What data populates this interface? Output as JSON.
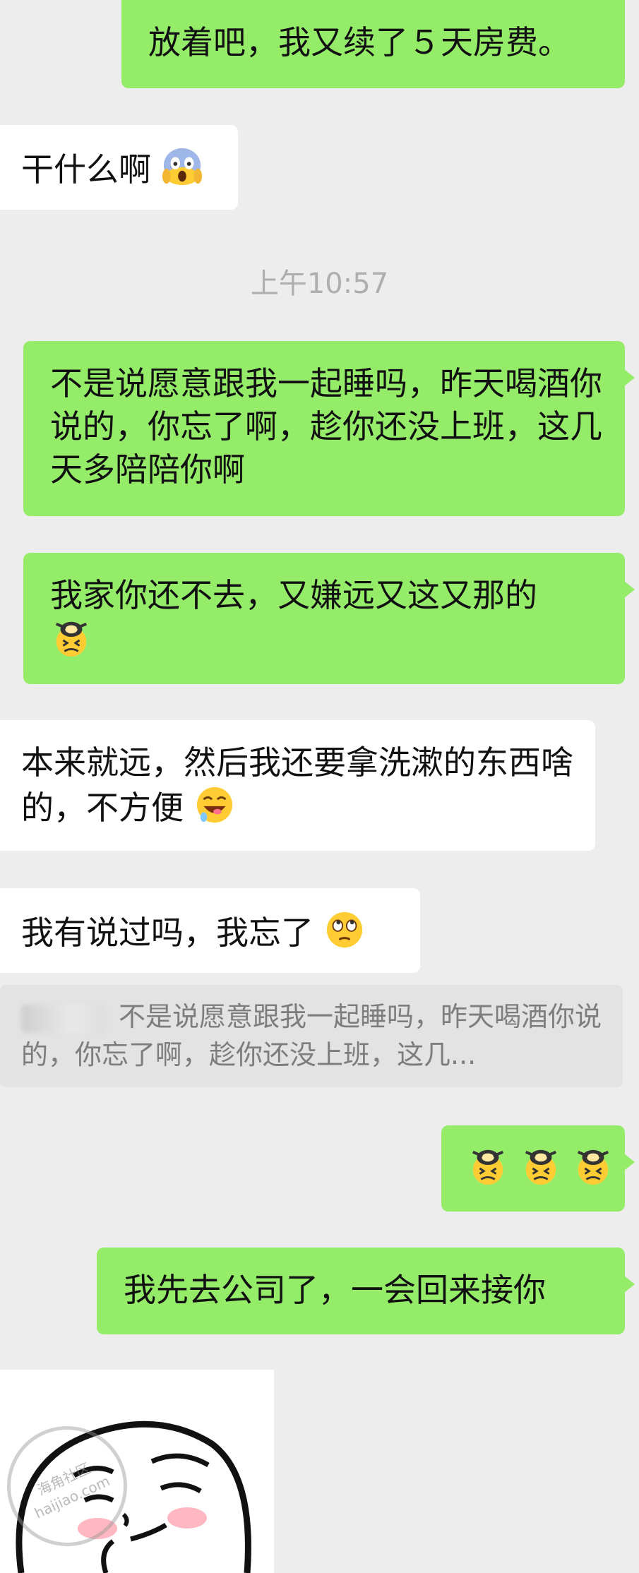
{
  "messages": {
    "m1": "放着吧，我又续了５天房费。",
    "m2": "干什么啊",
    "timestamp": "上午10:57",
    "m3": "不是说愿意跟我一起睡吗，昨天喝酒你说的，你忘了啊，趁你还没上班，这几天多陪陪你啊",
    "m4": "我家你还不去，又嫌远又这又那的",
    "m5": "本来就远，然后我还要拿洗漱的东西啥的，不方便",
    "m6": "我有说过吗，我忘了",
    "quote": "不是说愿意跟我一起睡吗，昨天喝酒你说的，你忘了啊，趁你还没上班，这几...",
    "m8": "我先去公司了，一会回来接你"
  },
  "watermark": {
    "line1": "海角社区",
    "line2": "haijiao.com"
  },
  "icons": {
    "scream": "face-screaming-in-fear-icon",
    "frustrated": "frustrated-spoon-face-sticker-icon",
    "drooling": "drooling-laughing-face-icon",
    "eyeroll": "face-with-rolling-eyes-icon"
  },
  "colors": {
    "background": "#ededed",
    "sent_bubble": "#95ec69",
    "received_bubble": "#ffffff",
    "timestamp": "#aeaeae",
    "quote_bg": "#e3e3e3"
  }
}
